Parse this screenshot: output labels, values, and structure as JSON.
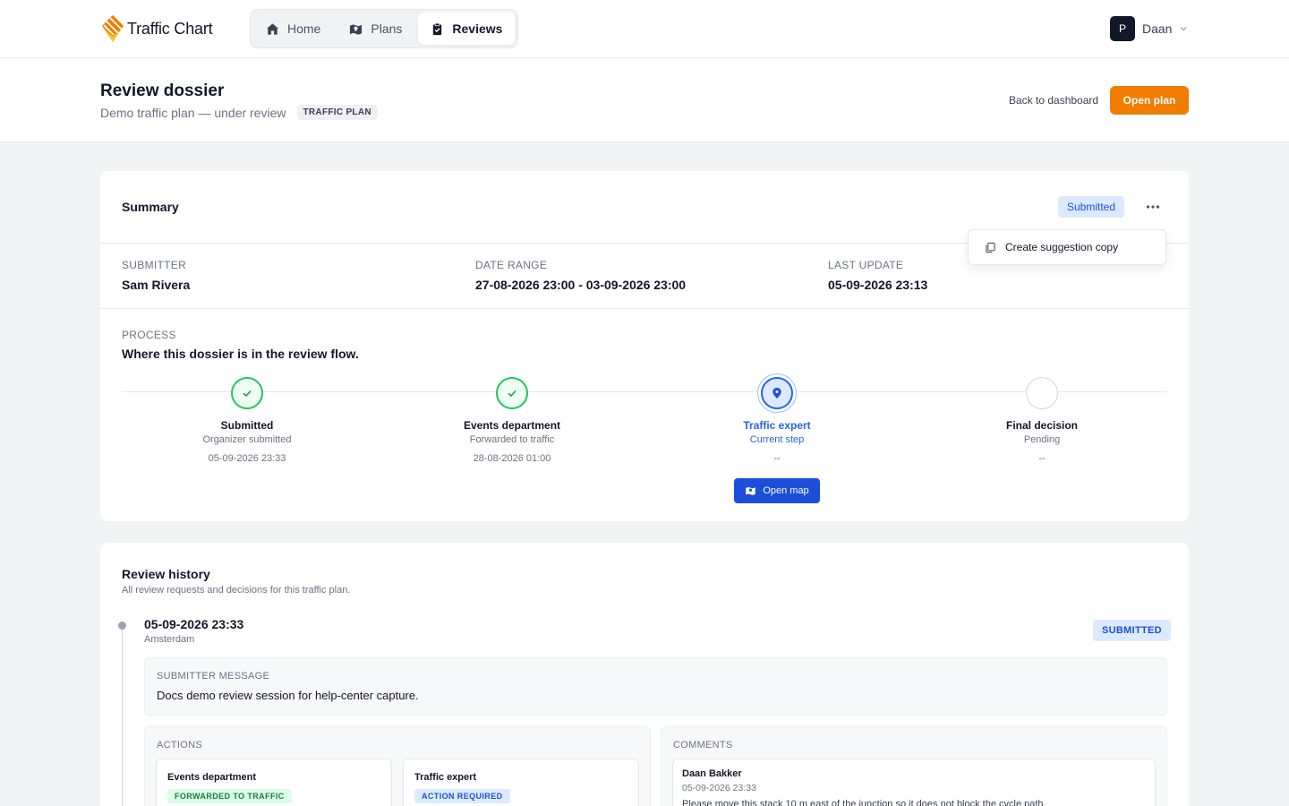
{
  "app": {
    "name": "Traffic Chart"
  },
  "nav": {
    "items": [
      {
        "label": "Home",
        "icon": "home-icon"
      },
      {
        "label": "Plans",
        "icon": "map-icon"
      },
      {
        "label": "Reviews",
        "icon": "clipboard-check-icon",
        "active": true
      }
    ]
  },
  "user": {
    "initial": "P",
    "name": "Daan"
  },
  "header": {
    "title": "Review dossier",
    "subtitle": "Demo traffic plan — under review",
    "tag": "TRAFFIC PLAN",
    "back_label": "Back to dashboard",
    "open_plan_label": "Open plan"
  },
  "summary": {
    "title": "Summary",
    "status": "Submitted",
    "menu_item": "Create suggestion copy",
    "meta": [
      {
        "label": "SUBMITTER",
        "value": "Sam Rivera"
      },
      {
        "label": "DATE RANGE",
        "value": "27-08-2026 23:00 - 03-09-2026 23:00"
      },
      {
        "label": "LAST UPDATE",
        "value": "05-09-2026 23:13"
      }
    ],
    "process": {
      "label": "PROCESS",
      "description": "Where this dossier is in the review flow.",
      "steps": [
        {
          "title": "Submitted",
          "status": "Organizer submitted",
          "date": "05-09-2026 23:33",
          "state": "done"
        },
        {
          "title": "Events department",
          "status": "Forwarded to traffic",
          "date": "28-08-2026 01:00",
          "state": "done"
        },
        {
          "title": "Traffic expert",
          "status": "Current step",
          "date": "--",
          "state": "current"
        },
        {
          "title": "Final decision",
          "status": "Pending",
          "date": "--",
          "state": "pending"
        }
      ],
      "open_map_label": "Open map"
    }
  },
  "history": {
    "title": "Review history",
    "subtitle": "All review requests and decisions for this traffic plan.",
    "entry": {
      "date": "05-09-2026 23:33",
      "location": "Amsterdam",
      "status": "SUBMITTED",
      "message_label": "SUBMITTER MESSAGE",
      "message": "Docs demo review session for help-center capture.",
      "actions_label": "ACTIONS",
      "actions": [
        {
          "title": "Events department",
          "status": "FORWARDED TO TRAFFIC",
          "tone": "green"
        },
        {
          "title": "Traffic expert",
          "status": "ACTION REQUIRED",
          "tone": "blue"
        }
      ],
      "comments_label": "COMMENTS",
      "comments": [
        {
          "author": "Daan Bakker",
          "date": "05-09-2026 23:33",
          "text": "Please move this stack 10 m east of the junction so it does not block the cycle path."
        }
      ]
    }
  },
  "colors": {
    "accent": "#f07d00",
    "primary": "#1d4ed8",
    "success": "#22c55e"
  }
}
